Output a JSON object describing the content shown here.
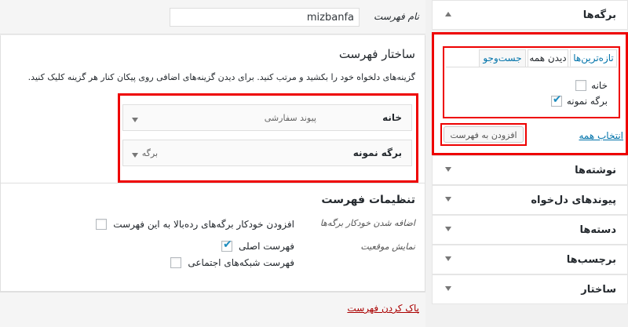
{
  "sidebar": {
    "pages": {
      "title": "برگه‌ها",
      "tabs": {
        "recent": "تازه‌ترین‌ها",
        "view_all": "دیدن همه",
        "search": "جست‌وجو"
      },
      "items": [
        {
          "label": "خانه",
          "checked": false
        },
        {
          "label": "برگه نمونه",
          "checked": true
        }
      ],
      "select_all": "انتخاب همه",
      "add_button": "افزودن به فهرست"
    },
    "sections": [
      {
        "title": "نوشته‌ها"
      },
      {
        "title": "پیوندهای دل‌خواه"
      },
      {
        "title": "دسته‌ها"
      },
      {
        "title": "برچسب‌ها"
      },
      {
        "title": "ساختار"
      }
    ]
  },
  "menu": {
    "name_label": "نام فهرست",
    "name_value": "mizbanfa",
    "structure_title": "ساختار فهرست",
    "structure_desc": "گزینه‌های دلخواه خود را بکشید و مرتب کنید. برای دیدن گزینه‌های اضافی روی پیکان کنار هر گزینه کلیک کنید.",
    "items": [
      {
        "title": "خانه",
        "type": "پیوند سفارشی"
      },
      {
        "title": "برگه نمونه",
        "type": "برگه"
      }
    ],
    "settings_title": "تنظیمات فهرست",
    "auto_add_label": "اضافه شدن خودکار برگه‌ها",
    "auto_add_option": {
      "label": "افزودن خودکار برگه‌های رده‌بالا به این فهرست",
      "checked": false
    },
    "location_label": "نمایش موقعیت",
    "locations": [
      {
        "label": "فهرست اصلی",
        "checked": true
      },
      {
        "label": "فهرست شبکه‌های اجتماعی",
        "checked": false
      }
    ],
    "delete_link": "پاک کردن فهرست"
  },
  "icons": {
    "accordion": "triangle-icon",
    "item_toggle": "triangle-down-icon"
  },
  "colors": {
    "highlight": "#ee0000",
    "link": "#0073aa",
    "delete": "#aa0000",
    "check": "#1e8cbe"
  }
}
